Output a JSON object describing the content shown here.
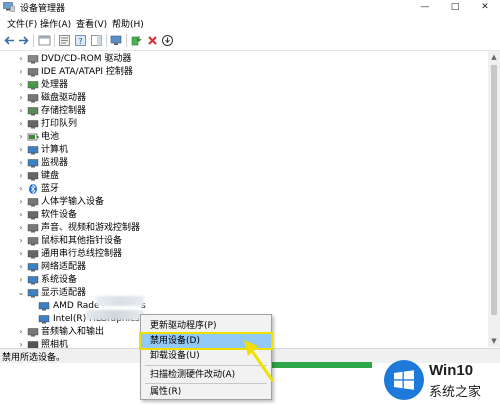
{
  "window": {
    "title": "设备管理器",
    "minimize": "—",
    "maximize": "□",
    "close": "✕"
  },
  "menu": [
    "文件(F)",
    "操作(A)",
    "查看(V)",
    "帮助(H)"
  ],
  "tree": {
    "categories": [
      {
        "label": "DVD/CD-ROM 驱动器",
        "icon": "dvd-drive-icon"
      },
      {
        "label": "IDE ATA/ATAPI 控制器",
        "icon": "ide-controller-icon"
      },
      {
        "label": "处理器",
        "icon": "processor-icon"
      },
      {
        "label": "磁盘驱动器",
        "icon": "disk-drive-icon"
      },
      {
        "label": "存储控制器",
        "icon": "storage-controller-icon"
      },
      {
        "label": "打印队列",
        "icon": "printer-icon"
      },
      {
        "label": "电池",
        "icon": "battery-icon"
      },
      {
        "label": "计算机",
        "icon": "computer-icon"
      },
      {
        "label": "监视器",
        "icon": "monitor-icon"
      },
      {
        "label": "键盘",
        "icon": "keyboard-icon"
      },
      {
        "label": "蓝牙",
        "icon": "bluetooth-icon"
      },
      {
        "label": "人体学输入设备",
        "icon": "hid-icon"
      },
      {
        "label": "软件设备",
        "icon": "software-device-icon"
      },
      {
        "label": "声音、视频和游戏控制器",
        "icon": "sound-icon"
      },
      {
        "label": "鼠标和其他指针设备",
        "icon": "mouse-icon"
      },
      {
        "label": "通用串行总线控制器",
        "icon": "usb-icon"
      },
      {
        "label": "网络适配器",
        "icon": "network-adapter-icon"
      },
      {
        "label": "系统设备",
        "icon": "system-device-icon"
      },
      {
        "label": "显示适配器",
        "icon": "display-adapter-icon"
      }
    ],
    "display_children": [
      {
        "label": "AMD Rade",
        "suffix": "s"
      },
      {
        "label": "Intel(R) HD",
        "suffix": "Graphics Family"
      }
    ],
    "after": [
      {
        "label": "音频输入和输出",
        "icon": "audio-io-icon"
      },
      {
        "label": "照相机",
        "icon": "camera-icon"
      }
    ]
  },
  "status": "禁用所选设备。",
  "context_menu": {
    "items": [
      "更新驱动程序(P)",
      "禁用设备(D)",
      "卸载设备(U)",
      "扫描检测硬件改动(A)",
      "属性(R)"
    ],
    "highlighted_index": 1
  },
  "watermark": {
    "title": "Win10",
    "subtitle": "系统之家"
  },
  "colors": {
    "highlight": "#91c9f7",
    "highlight_outline": "#f0e000",
    "arrow": "#f0e000",
    "watermark_blue": "#1e7ad8"
  }
}
